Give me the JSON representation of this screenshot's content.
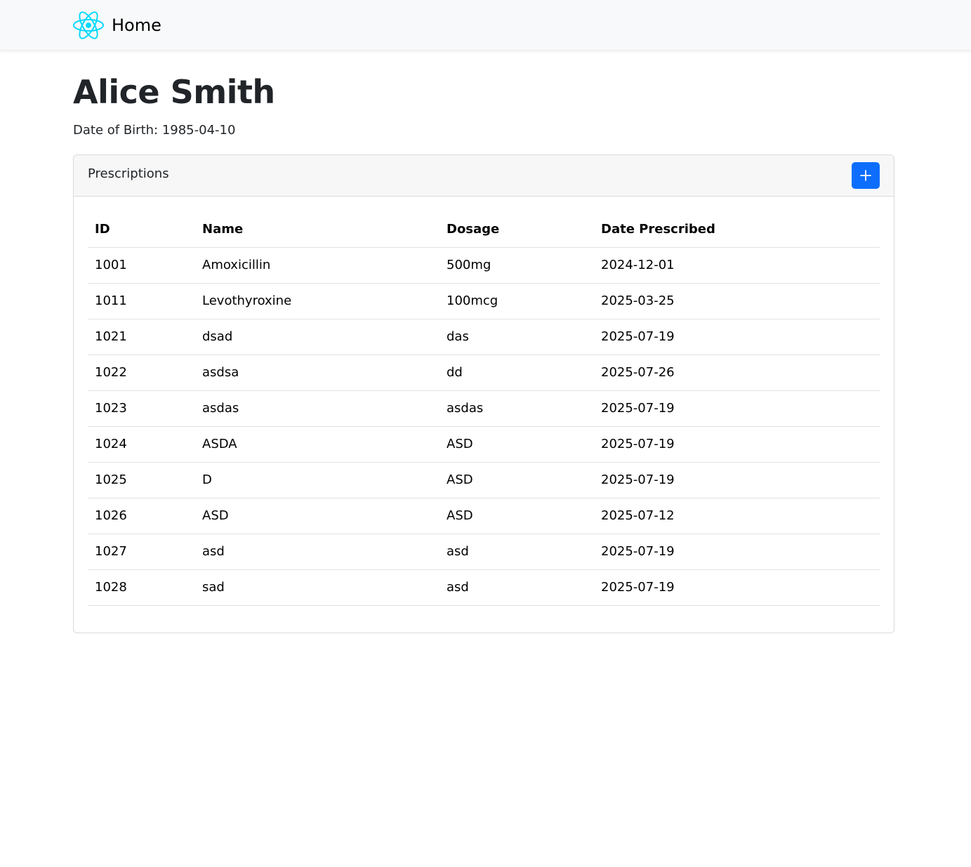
{
  "navbar": {
    "brand_label": "Home",
    "logo_icon": "react-logo-icon",
    "logo_color": "#00d8ff"
  },
  "patient": {
    "name": "Alice Smith",
    "dob": "Date of Birth: 1985-04-10"
  },
  "prescriptions": {
    "title": "Prescriptions",
    "add_button_icon": "plus-icon",
    "add_button_color": "#0d6efd",
    "columns": [
      "ID",
      "Name",
      "Dosage",
      "Date Prescribed"
    ],
    "rows": [
      {
        "id": "1001",
        "name": "Amoxicillin",
        "dosage": "500mg",
        "date": "2024-12-01"
      },
      {
        "id": "1011",
        "name": "Levothyroxine",
        "dosage": "100mcg",
        "date": "2025-03-25"
      },
      {
        "id": "1021",
        "name": "dsad",
        "dosage": "das",
        "date": "2025-07-19"
      },
      {
        "id": "1022",
        "name": "asdsa",
        "dosage": "dd",
        "date": "2025-07-26"
      },
      {
        "id": "1023",
        "name": "asdas",
        "dosage": "asdas",
        "date": "2025-07-19"
      },
      {
        "id": "1024",
        "name": "ASDA",
        "dosage": "ASD",
        "date": "2025-07-19"
      },
      {
        "id": "1025",
        "name": "D",
        "dosage": "ASD",
        "date": "2025-07-19"
      },
      {
        "id": "1026",
        "name": "ASD",
        "dosage": "ASD",
        "date": "2025-07-12"
      },
      {
        "id": "1027",
        "name": "asd",
        "dosage": "asd",
        "date": "2025-07-19"
      },
      {
        "id": "1028",
        "name": "sad",
        "dosage": "asd",
        "date": "2025-07-19"
      }
    ]
  }
}
